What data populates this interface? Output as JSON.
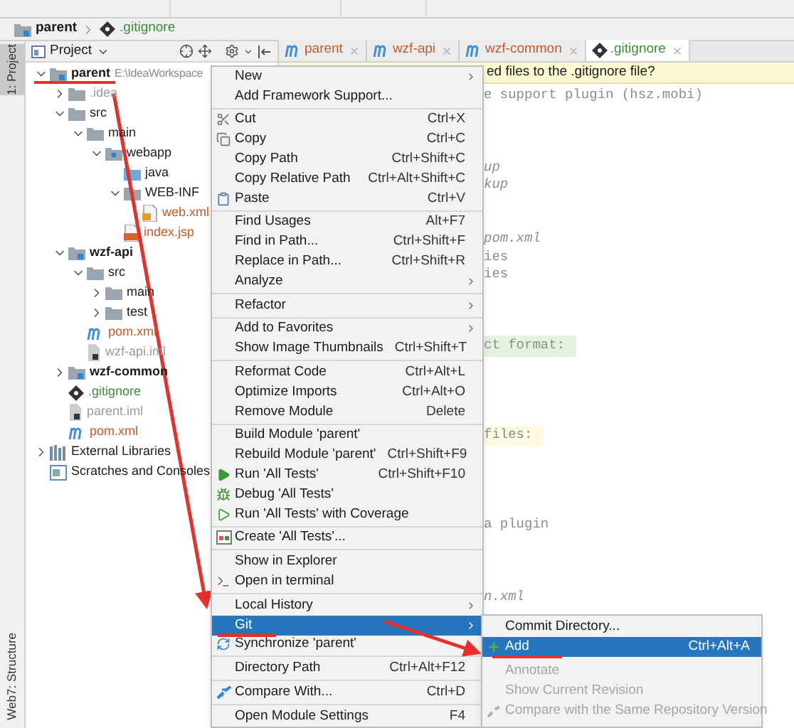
{
  "breadcrumb": [
    {
      "label": "parent",
      "kind": "module"
    },
    {
      "label": ".gitignore",
      "kind": "gitignore"
    }
  ],
  "tool_strip": [
    {
      "label": "1: Project",
      "selected": true
    },
    {
      "label": "7: Structure",
      "selected": false
    },
    {
      "label": "Web",
      "selected": false
    }
  ],
  "project_panel": {
    "title": "Project"
  },
  "tree": [
    {
      "label": "parent",
      "hint": "E:\\IdeaWorkspace",
      "kind": "module",
      "color": "#1a1a1a",
      "expanded": true,
      "children": [
        {
          "label": ".idea",
          "kind": "folder",
          "color": "#9a9a9a",
          "expanded": false
        },
        {
          "label": "src",
          "kind": "folder",
          "color": "#1a1a1a",
          "expanded": true,
          "children": [
            {
              "label": "main",
              "kind": "folder",
              "color": "#1a1a1a",
              "expanded": true,
              "children": [
                {
                  "label": "webapp",
                  "kind": "webfolder",
                  "color": "#1a1a1a",
                  "expanded": true,
                  "children": [
                    {
                      "label": "java",
                      "kind": "source",
                      "color": "#1a1a1a"
                    },
                    {
                      "label": "WEB-INF",
                      "kind": "folder",
                      "color": "#1a1a1a",
                      "expanded": true,
                      "children": [
                        {
                          "label": "web.xml",
                          "kind": "xml",
                          "color": "#c65a2a"
                        }
                      ]
                    },
                    {
                      "label": "index.jsp",
                      "kind": "jsp",
                      "color": "#c65a2a"
                    }
                  ]
                }
              ]
            }
          ]
        },
        {
          "label": "wzf-api",
          "kind": "module",
          "color": "#1a1a1a",
          "expanded": true,
          "children": [
            {
              "label": "src",
              "kind": "folder",
              "color": "#1a1a1a",
              "expanded": true,
              "children": [
                {
                  "label": "main",
                  "kind": "folder",
                  "color": "#1a1a1a",
                  "expanded": false
                },
                {
                  "label": "test",
                  "kind": "folder",
                  "color": "#1a1a1a",
                  "expanded": false
                }
              ]
            },
            {
              "label": "pom.xml",
              "kind": "pom",
              "color": "#c65a2a"
            },
            {
              "label": "wzf-api.iml",
              "kind": "iml",
              "color": "#9a9a9a"
            }
          ]
        },
        {
          "label": "wzf-common",
          "kind": "module",
          "color": "#1a1a1a",
          "expanded": false
        },
        {
          "label": ".gitignore",
          "kind": "gitignore",
          "color": "#3b8f3b"
        },
        {
          "label": "parent.iml",
          "kind": "iml",
          "color": "#9a9a9a"
        },
        {
          "label": "pom.xml",
          "kind": "pom",
          "color": "#c65a2a"
        }
      ]
    },
    {
      "label": "External Libraries",
      "kind": "libraries",
      "color": "#1a1a1a",
      "expanded": false
    },
    {
      "label": "Scratches and Consoles",
      "kind": "scratches",
      "color": "#1a1a1a"
    }
  ],
  "editor_tabs": [
    {
      "label": "parent",
      "kind": "pom",
      "selected": false
    },
    {
      "label": "wzf-api",
      "kind": "pom",
      "selected": false
    },
    {
      "label": "wzf-common",
      "kind": "pom",
      "selected": false
    },
    {
      "label": ".gitignore",
      "kind": "gitignore",
      "selected": true
    }
  ],
  "notification": "ed files to the .gitignore file?",
  "code_lines": [
    {
      "kind": "comment",
      "text": "e support plugin (hsz.mobi)"
    },
    {
      "kind": "blank"
    },
    {
      "kind": "blank"
    },
    {
      "kind": "blank"
    },
    {
      "kind": "italic",
      "text": "up"
    },
    {
      "kind": "italic",
      "text": "kup"
    },
    {
      "kind": "blank"
    },
    {
      "kind": "blank"
    },
    {
      "kind": "italic",
      "text": "pom.xml"
    },
    {
      "kind": "comment",
      "text": "ies"
    },
    {
      "kind": "comment",
      "text": "ies"
    },
    {
      "kind": "blank"
    },
    {
      "kind": "blank"
    },
    {
      "kind": "blank"
    },
    {
      "kind": "header",
      "text": "ct format:"
    },
    {
      "kind": "blank"
    },
    {
      "kind": "blank"
    },
    {
      "kind": "blank"
    },
    {
      "kind": "blank"
    },
    {
      "kind": "current",
      "text": "files:"
    },
    {
      "kind": "blank"
    },
    {
      "kind": "blank"
    },
    {
      "kind": "blank"
    },
    {
      "kind": "blank"
    },
    {
      "kind": "comment",
      "text": "a plugin"
    },
    {
      "kind": "blank"
    },
    {
      "kind": "blank"
    },
    {
      "kind": "blank"
    },
    {
      "kind": "italic",
      "text": "n.xml"
    }
  ],
  "context_menu": {
    "items": [
      {
        "kind": "item",
        "label": "New",
        "submenu": true,
        "selected": false
      },
      {
        "kind": "item",
        "label": "Add Framework Support...",
        "submenu": false,
        "selected": false
      },
      {
        "kind": "separator"
      },
      {
        "kind": "item",
        "label": "Cut",
        "shortcut": "Ctrl+X",
        "submenu": false,
        "selected": false
      },
      {
        "kind": "item",
        "label": "Copy",
        "shortcut": "Ctrl+C",
        "submenu": false,
        "selected": false
      },
      {
        "kind": "item",
        "label": "Copy Path",
        "shortcut": "Ctrl+Shift+C",
        "submenu": false,
        "selected": false
      },
      {
        "kind": "item",
        "label": "Copy Relative Path",
        "shortcut": "Ctrl+Alt+Shift+C",
        "submenu": false,
        "selected": false
      },
      {
        "kind": "item",
        "label": "Paste",
        "shortcut": "Ctrl+V",
        "submenu": false,
        "selected": false
      },
      {
        "kind": "separator"
      },
      {
        "kind": "item",
        "label": "Find Usages",
        "shortcut": "Alt+F7",
        "submenu": false,
        "selected": false
      },
      {
        "kind": "item",
        "label": "Find in Path...",
        "shortcut": "Ctrl+Shift+F",
        "submenu": false,
        "selected": false
      },
      {
        "kind": "item",
        "label": "Replace in Path...",
        "shortcut": "Ctrl+Shift+R",
        "submenu": false,
        "selected": false
      },
      {
        "kind": "item",
        "label": "Analyze",
        "submenu": true,
        "selected": false
      },
      {
        "kind": "separator"
      },
      {
        "kind": "item",
        "label": "Refactor",
        "submenu": true,
        "selected": false
      },
      {
        "kind": "separator"
      },
      {
        "kind": "item",
        "label": "Add to Favorites",
        "submenu": true,
        "selected": false
      },
      {
        "kind": "item",
        "label": "Show Image Thumbnails",
        "shortcut": "Ctrl+Shift+T",
        "submenu": false,
        "selected": false
      },
      {
        "kind": "separator"
      },
      {
        "kind": "item",
        "label": "Reformat Code",
        "shortcut": "Ctrl+Alt+L",
        "submenu": false,
        "selected": false
      },
      {
        "kind": "item",
        "label": "Optimize Imports",
        "shortcut": "Ctrl+Alt+O",
        "submenu": false,
        "selected": false
      },
      {
        "kind": "item",
        "label": "Remove Module",
        "shortcut": "Delete",
        "submenu": false,
        "selected": false
      },
      {
        "kind": "separator"
      },
      {
        "kind": "item",
        "label": "Build Module 'parent'",
        "submenu": false,
        "selected": false
      },
      {
        "kind": "item",
        "label": "Rebuild Module 'parent'",
        "shortcut": "Ctrl+Shift+F9",
        "submenu": false,
        "selected": false
      },
      {
        "kind": "item",
        "label": "Run 'All Tests'",
        "shortcut": "Ctrl+Shift+F10",
        "submenu": false,
        "selected": false
      },
      {
        "kind": "item",
        "label": "Debug 'All Tests'",
        "submenu": false,
        "selected": false
      },
      {
        "kind": "item",
        "label": "Run 'All Tests' with Coverage",
        "submenu": false,
        "selected": false
      },
      {
        "kind": "separator"
      },
      {
        "kind": "item",
        "label": "Create 'All Tests'...",
        "submenu": false,
        "selected": false
      },
      {
        "kind": "separator"
      },
      {
        "kind": "item",
        "label": "Show in Explorer",
        "submenu": false,
        "selected": false
      },
      {
        "kind": "item",
        "label": "Open in terminal",
        "submenu": false,
        "selected": false
      },
      {
        "kind": "separator"
      },
      {
        "kind": "item",
        "label": "Local History",
        "submenu": true,
        "selected": false
      },
      {
        "kind": "item",
        "label": "Git",
        "submenu": true,
        "selected": true
      },
      {
        "kind": "item",
        "label": "Synchronize 'parent'",
        "submenu": false,
        "selected": false
      },
      {
        "kind": "separator"
      },
      {
        "kind": "item",
        "label": "Directory Path",
        "shortcut": "Ctrl+Alt+F12",
        "submenu": false,
        "selected": false
      },
      {
        "kind": "separator"
      },
      {
        "kind": "item",
        "label": "Compare With...",
        "shortcut": "Ctrl+D",
        "submenu": false,
        "selected": false
      },
      {
        "kind": "separator"
      },
      {
        "kind": "item",
        "label": "Open Module Settings",
        "shortcut": "F4",
        "submenu": false,
        "selected": false
      }
    ]
  },
  "git_submenu": {
    "items": [
      {
        "kind": "item",
        "label": "Commit Directory...",
        "selected": false,
        "disabled": false
      },
      {
        "kind": "item",
        "label": "Add",
        "shortcut": "Ctrl+Alt+A",
        "selected": true,
        "disabled": false
      },
      {
        "kind": "separator"
      },
      {
        "kind": "item",
        "label": "Annotate",
        "selected": false,
        "disabled": true
      },
      {
        "kind": "item",
        "label": "Show Current Revision",
        "selected": false,
        "disabled": true
      },
      {
        "kind": "item",
        "label": "Compare with the Same Repository Version",
        "selected": false,
        "disabled": true
      }
    ]
  }
}
